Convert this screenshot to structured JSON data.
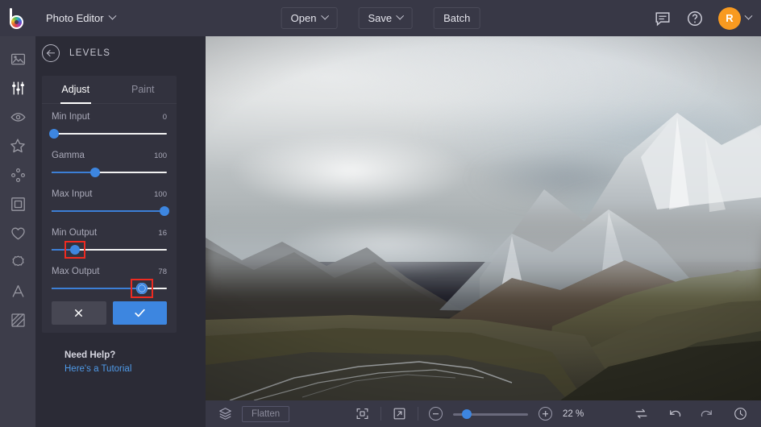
{
  "topbar": {
    "logo_icon": "bulb-color-wheel-logo",
    "app_title": "Photo Editor",
    "buttons": [
      {
        "label": "Open",
        "has_caret": true,
        "name": "open-button"
      },
      {
        "label": "Save",
        "has_caret": true,
        "name": "save-button"
      },
      {
        "label": "Batch",
        "has_caret": false,
        "name": "batch-button"
      }
    ],
    "feedback_icon": "comment-icon",
    "help_icon": "question-circle-icon",
    "avatar_initial": "R",
    "avatar_color": "#f89a20"
  },
  "rail": {
    "items": [
      {
        "icon": "image-icon",
        "name": "sidebar-item-image",
        "active": false
      },
      {
        "icon": "sliders-icon",
        "name": "sidebar-item-adjust",
        "active": true
      },
      {
        "icon": "eye-icon",
        "name": "sidebar-item-retouch",
        "active": false
      },
      {
        "icon": "star-icon",
        "name": "sidebar-item-effects",
        "active": false
      },
      {
        "icon": "nodes-icon",
        "name": "sidebar-item-beautify",
        "active": false
      },
      {
        "icon": "frame-icon",
        "name": "sidebar-item-frames",
        "active": false
      },
      {
        "icon": "heart-icon",
        "name": "sidebar-item-stickers",
        "active": false
      },
      {
        "icon": "badge-icon",
        "name": "sidebar-item-overlays",
        "active": false
      },
      {
        "icon": "text-a-icon",
        "name": "sidebar-item-text",
        "active": false
      },
      {
        "icon": "texture-icon",
        "name": "sidebar-item-texture",
        "active": false
      }
    ]
  },
  "panel": {
    "back_icon": "back-arrow-icon",
    "title": "LEVELS",
    "tabs": [
      {
        "label": "Adjust",
        "active": true
      },
      {
        "label": "Paint",
        "active": false
      }
    ],
    "sliders": [
      {
        "label": "Min Input",
        "value": "0",
        "pct": 0,
        "highlight": false,
        "ring": false
      },
      {
        "label": "Gamma",
        "value": "100",
        "pct": 38,
        "highlight": false,
        "ring": false
      },
      {
        "label": "Max Input",
        "value": "100",
        "pct": 100,
        "highlight": false,
        "ring": false
      },
      {
        "label": "Min Output",
        "value": "16",
        "pct": 20,
        "highlight": true,
        "ring": false
      },
      {
        "label": "Max Output",
        "value": "78",
        "pct": 78,
        "highlight": true,
        "ring": true
      }
    ],
    "cancel_icon": "close-x-icon",
    "apply_icon": "checkmark-icon",
    "help_title": "Need Help?",
    "help_link": "Here's a Tutorial"
  },
  "bottombar": {
    "layers_icon": "layers-icon",
    "flatten_label": "Flatten",
    "fit_icon": "fit-to-screen-icon",
    "fullscreen_icon": "expand-arrow-icon",
    "zoom_out_icon": "minus-circle-icon",
    "zoom_in_icon": "plus-circle-icon",
    "zoom_value": "22 %",
    "zoom_pct": 18,
    "compare_icon": "compare-swap-icon",
    "undo_icon": "undo-arrow-icon",
    "redo_icon": "redo-arrow-icon",
    "history_icon": "history-clock-icon"
  },
  "canvas": {
    "image_alt": "snow-capped-mountain-range-over-dark-tundra-valley-with-braided-river"
  },
  "colors": {
    "topbar_bg": "#383846",
    "rail_bg": "#3d3d4a",
    "panel_bg": "#2b2b36",
    "card_bg": "#32323e",
    "accent_blue": "#3d86e0",
    "highlight_red": "#ee2b21",
    "avatar_orange": "#f89a20"
  }
}
